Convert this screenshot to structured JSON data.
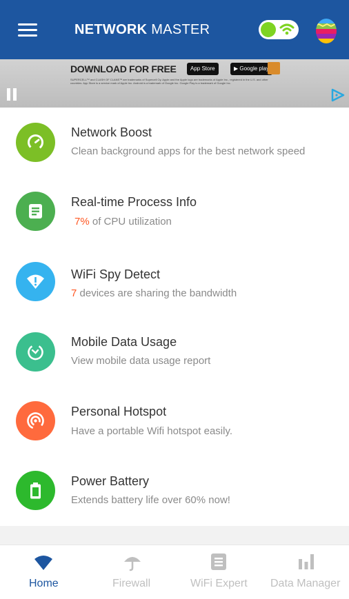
{
  "header": {
    "title_bold": "NETWORK",
    "title_light": "MASTER",
    "wifi_toggle_on": true
  },
  "ad": {
    "headline": "DOWNLOAD FOR FREE",
    "app_store": "App Store",
    "google_play": "Google play",
    "fine_print": "SUPERCELL™ and CLASH OF CLANS™ are trademarks of Supercell Oy. Apple and the Apple logo are trademarks of Apple Inc., registered in the U.S. and other countries. App Store is a service mark of Apple Inc. Android is a trademark of Google Inc. Google Play is a trademark of Google Inc."
  },
  "features": [
    {
      "title": "Network Boost",
      "subtitle": "Clean background apps for the best network speed",
      "color": "#7cbf26",
      "icon": "speedometer-icon"
    },
    {
      "title": "Real-time Process Info",
      "highlight": "7%",
      "subtitle": " of CPU utilization",
      "color": "#4caf50",
      "icon": "document-icon"
    },
    {
      "title": "WiFi Spy Detect",
      "highlight": "7",
      "subtitle": " devices are sharing the bandwidth",
      "color": "#35b3ef",
      "icon": "wifi-alert-icon"
    },
    {
      "title": "Mobile Data Usage",
      "subtitle": "View mobile data usage report",
      "color": "#3bbf8e",
      "icon": "data-timer-icon"
    },
    {
      "title": "Personal Hotspot",
      "subtitle": "Have a portable Wifi hotspot easily.",
      "color": "#ff6a3d",
      "icon": "hotspot-icon"
    },
    {
      "title": "Power Battery",
      "subtitle": "Extends battery life over 60% now!",
      "color": "#2db92d",
      "icon": "battery-icon"
    }
  ],
  "tabs": [
    {
      "label": "Home",
      "active": true,
      "icon": "wifi-icon"
    },
    {
      "label": "Firewall",
      "active": false,
      "icon": "umbrella-icon"
    },
    {
      "label": "WiFi Expert",
      "active": false,
      "icon": "document-icon"
    },
    {
      "label": "Data Manager",
      "active": false,
      "icon": "bar-chart-icon"
    }
  ],
  "colors": {
    "header": "#1d56a0",
    "accent_active": "#1d56a0",
    "inactive": "#bfbfbf",
    "highlight": "#ff5722"
  }
}
